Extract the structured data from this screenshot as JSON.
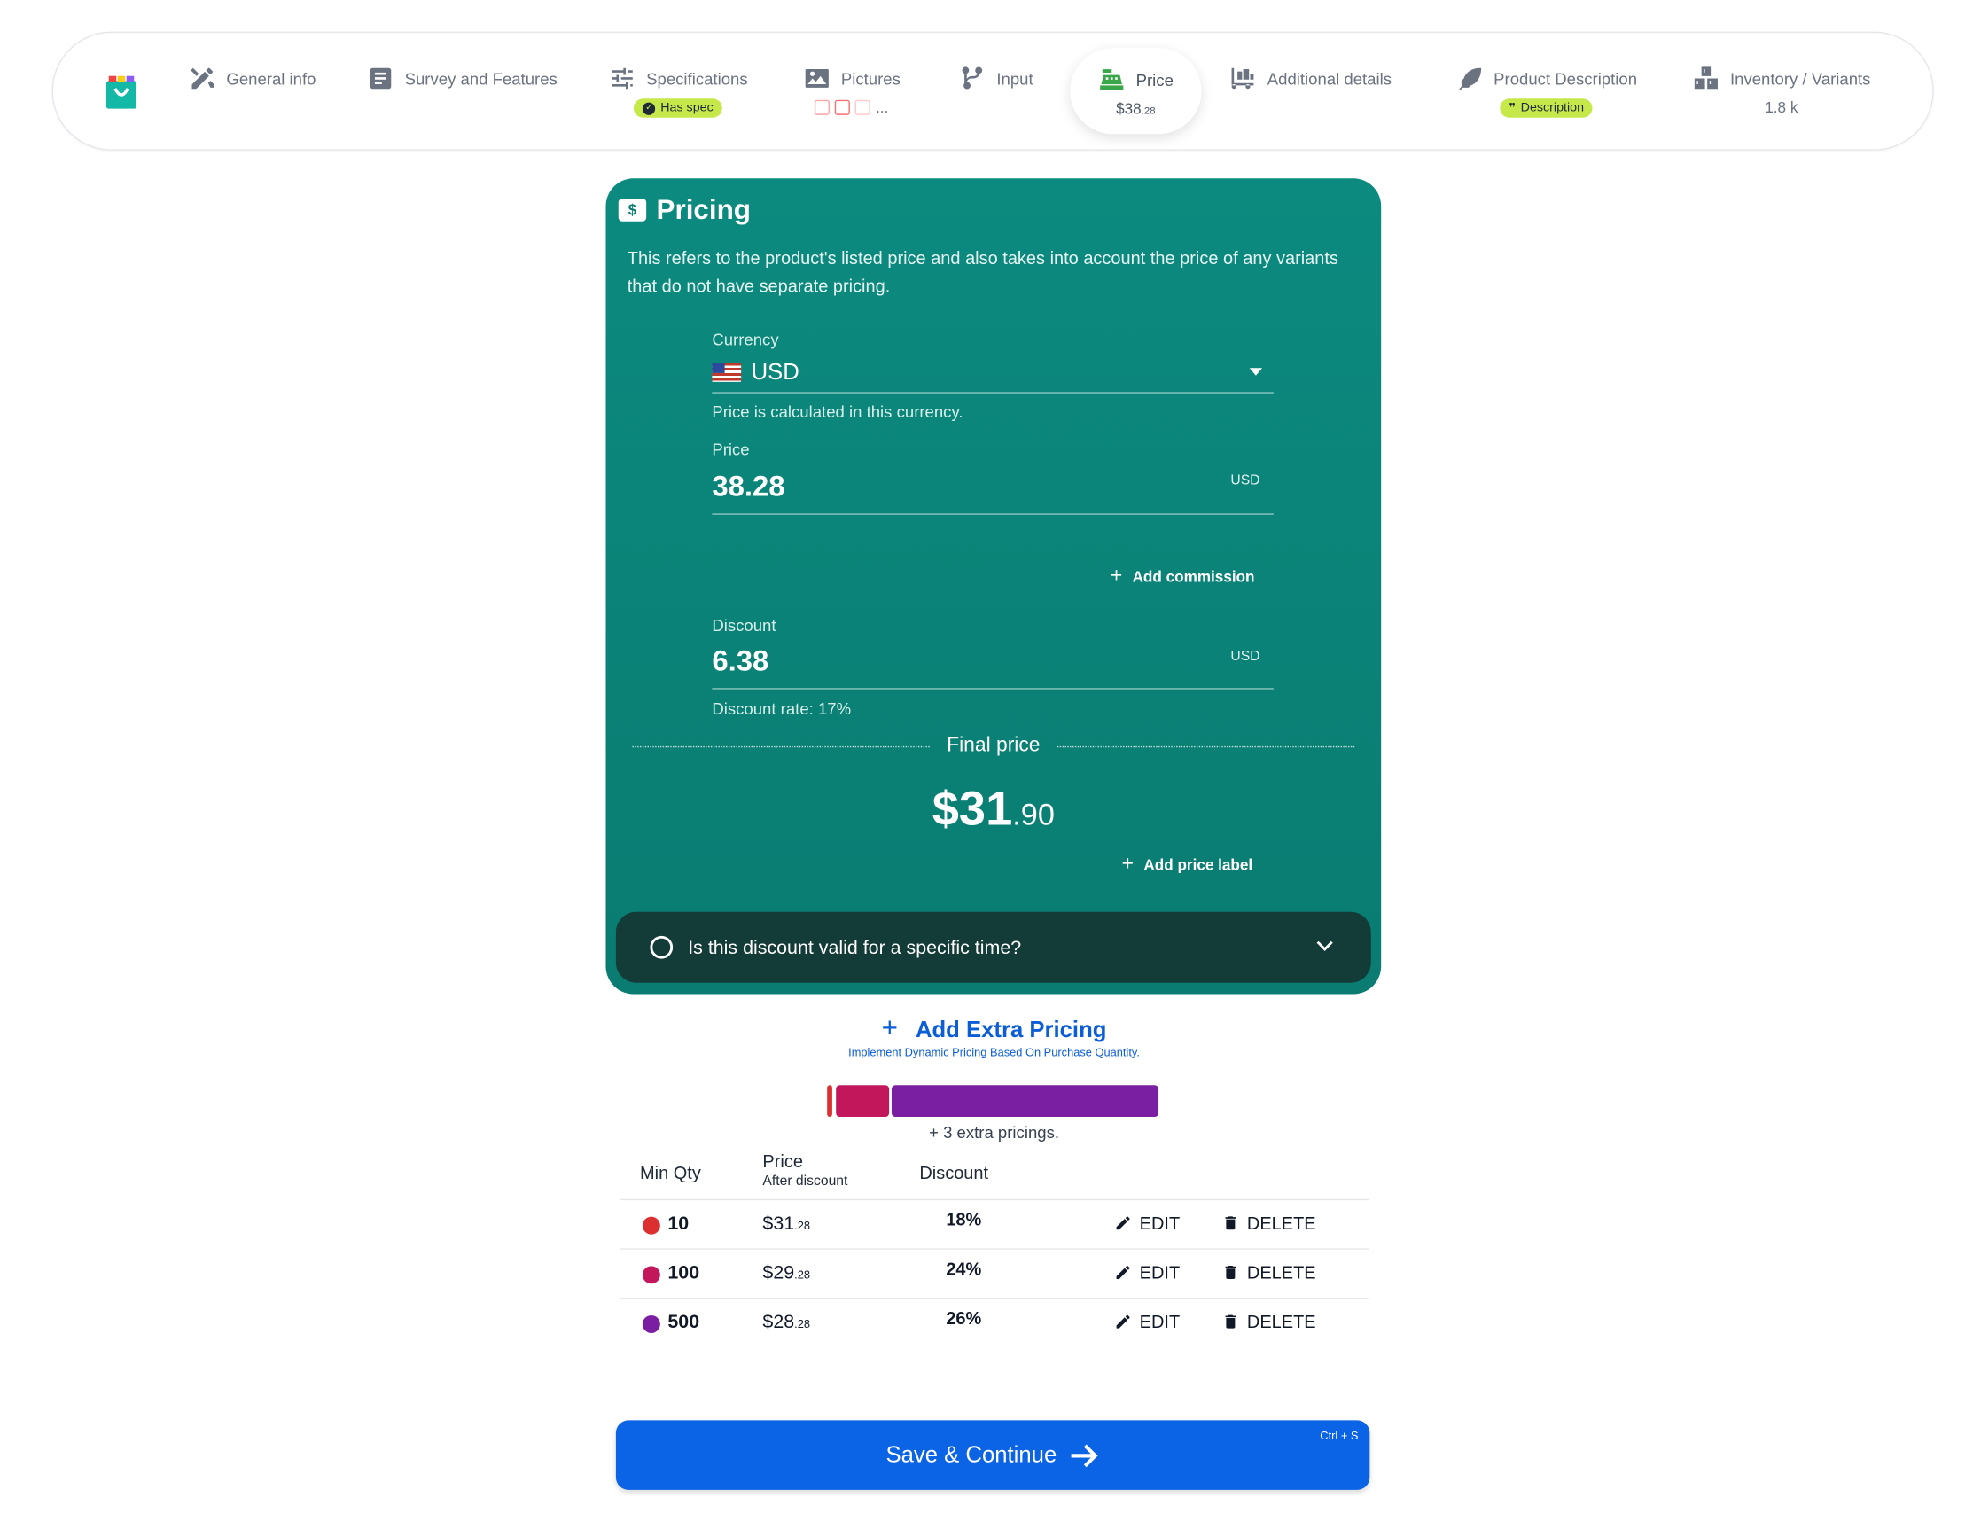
{
  "nav": {
    "steps": [
      {
        "label": "General info"
      },
      {
        "label": "Survey and Features"
      },
      {
        "label": "Specifications",
        "badge": "Has spec"
      },
      {
        "label": "Pictures",
        "more": "..."
      },
      {
        "label": "Input"
      },
      {
        "label": "Price",
        "price_main": "$38",
        "price_cents": ".28"
      },
      {
        "label": "Additional details"
      },
      {
        "label": "Product Description",
        "badge": "Description"
      },
      {
        "label": "Inventory / Variants",
        "sub": "1.8 k"
      }
    ]
  },
  "pricing": {
    "title": "Pricing",
    "title_icon": "$",
    "description": "This refers to the product's listed price and also takes into account the price of any variants that do not have separate pricing.",
    "currency_label": "Currency",
    "currency_value": "USD",
    "currency_hint": "Price is calculated in this currency.",
    "price_label": "Price",
    "price_value": "38.28",
    "price_unit": "USD",
    "add_commission": "Add commission",
    "discount_label": "Discount",
    "discount_value": "6.38",
    "discount_unit": "USD",
    "discount_rate": "Discount rate: 17%",
    "final_label": "Final price",
    "final_main": "$31",
    "final_cents": ".90",
    "add_price_label": "Add price label",
    "time_question": "Is this discount valid for a specific time?"
  },
  "extra": {
    "title": "Add Extra Pricing",
    "subtitle": "Implement Dynamic Pricing Based On Purchase Quantity.",
    "count_text": "+ 3 extra pricings.",
    "headers": {
      "qty": "Min Qty",
      "price": "Price",
      "price_sub": "After discount",
      "discount": "Discount"
    },
    "edit_label": "EDIT",
    "delete_label": "DELETE",
    "rows": [
      {
        "qty": "10",
        "price_main": "$31",
        "price_cents": ".28",
        "discount": "18%",
        "color": "#dc2f2f"
      },
      {
        "qty": "100",
        "price_main": "$29",
        "price_cents": ".28",
        "discount": "24%",
        "color": "#c2185b"
      },
      {
        "qty": "500",
        "price_main": "$28",
        "price_cents": ".28",
        "discount": "26%",
        "color": "#7b1fa2"
      }
    ]
  },
  "save": {
    "label": "Save & Continue",
    "shortcut": "Ctrl + S"
  },
  "colors": {
    "card": "#0a7c71",
    "accent": "#0b63e5",
    "chip": "#c6e84b"
  }
}
